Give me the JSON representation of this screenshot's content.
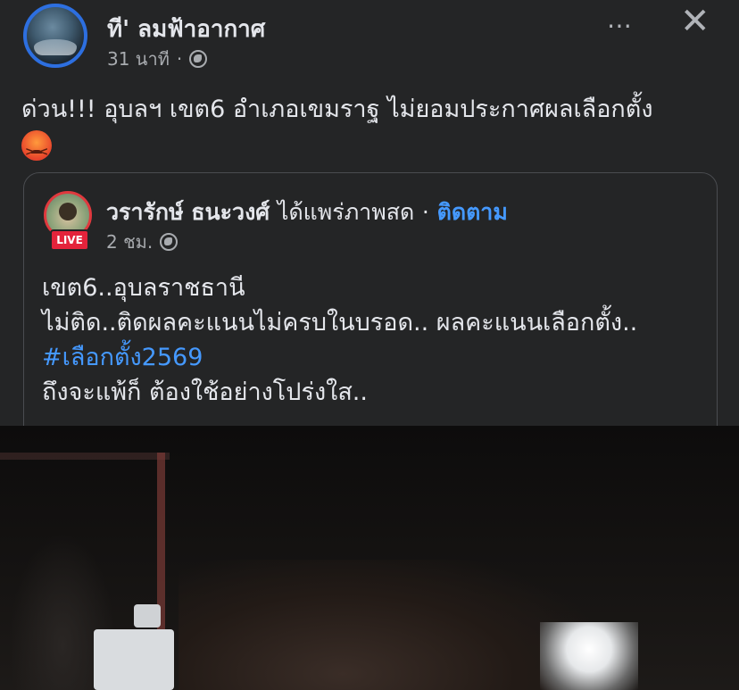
{
  "post": {
    "page_name": "ที' ลมฟ้าอากาศ",
    "time": "31 นาที",
    "dot": "·",
    "more_icon": "⋯",
    "close_icon": "✕",
    "text": "ด่วน!!! อุบลฯ เขต6 อำเภอเขมราฐ ไม่ยอมประกาศผลเลือกตั้ง"
  },
  "shared": {
    "author": "วรารักษ์ ธนะวงศ์",
    "action": "ได้แพร่ภาพสด",
    "dot": "·",
    "follow": "ติดตาม",
    "live_badge": "LIVE",
    "time": "2 ชม.",
    "lines": [
      "เขต6..อุบลราชธานี",
      "ไม่ติด..ติดผลคะแนนไม่ครบในบรอด.. ผลคะแนนเลือกตั้ง..",
      "#เลือกตั้ง2569",
      "ถึงจะแพ้ก็ ต้องใช้อย่างโปร่งใส.."
    ]
  },
  "colors": {
    "background": "#242526",
    "link": "#4599ff",
    "live": "#e4233b"
  }
}
